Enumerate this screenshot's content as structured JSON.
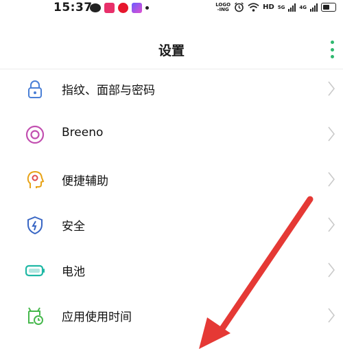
{
  "status_bar": {
    "time": "15:37",
    "left_icons": [
      "wechat-icon",
      "app-icon",
      "weibo-icon",
      "app-icon",
      "notification-dot-icon"
    ],
    "right_logo_text": "LOGO\n-ING",
    "hd_label": "HD",
    "sim1_tech": "5G",
    "sim2_tech": "4G"
  },
  "header": {
    "title": "设置"
  },
  "settings_items": [
    {
      "label": "指纹、面部与密码",
      "icon": "lock-icon",
      "color": "#4a7fd6"
    },
    {
      "label": "Breeno",
      "icon": "breeno-icon",
      "color": "#c24fb0"
    },
    {
      "label": "便捷辅助",
      "icon": "assist-icon",
      "color": "#e8a317"
    },
    {
      "label": "安全",
      "icon": "shield-icon",
      "color": "#3866c4"
    },
    {
      "label": "电池",
      "icon": "battery-icon",
      "color": "#1fb8a5"
    },
    {
      "label": "应用使用时间",
      "icon": "app-timer-icon",
      "color": "#46b84c"
    }
  ],
  "annotation": {
    "arrow_color": "#e53935"
  }
}
